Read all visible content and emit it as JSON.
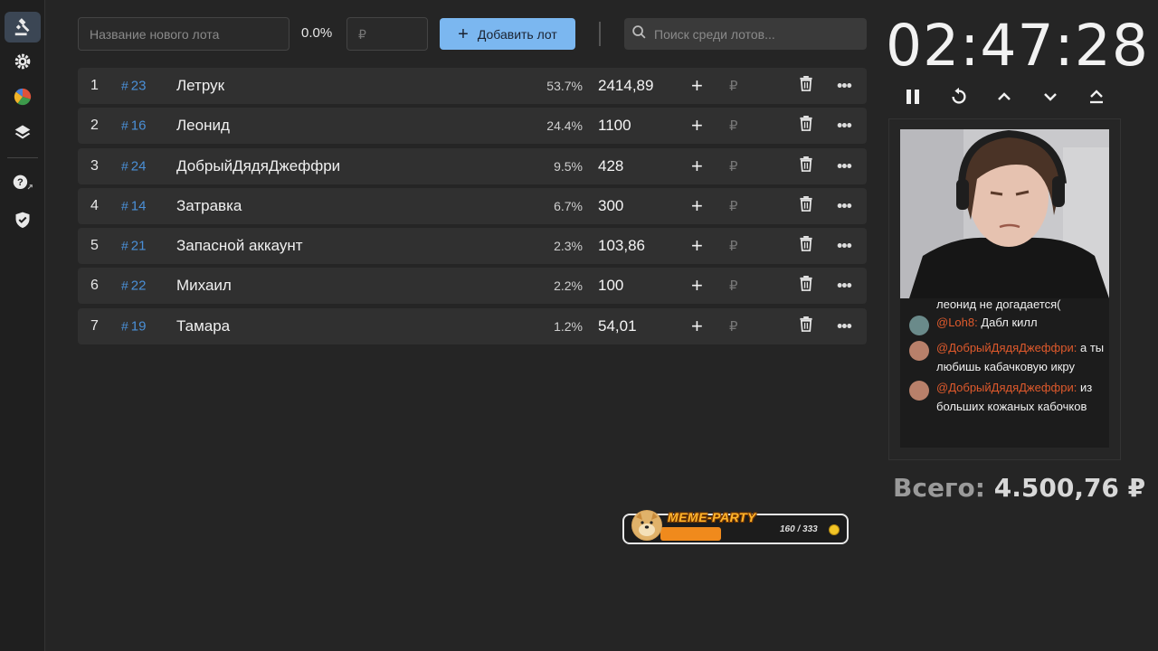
{
  "sidebar": {
    "items": [
      {
        "icon": "gavel-icon",
        "active": true
      },
      {
        "icon": "gear-icon"
      },
      {
        "icon": "pie-chart-icon"
      },
      {
        "icon": "layers-icon"
      },
      {
        "icon": "help-icon"
      },
      {
        "icon": "shield-check-icon"
      }
    ]
  },
  "toolbar": {
    "lot_name_placeholder": "Название нового лота",
    "percent": "0.0%",
    "amount_placeholder": "₽",
    "add_label": "Добавить лот",
    "search_placeholder": "Поиск среди лотов..."
  },
  "lots": [
    {
      "idx": "1",
      "num": "23",
      "name": "Летрук",
      "pct": "53.7%",
      "amount": "2414,89"
    },
    {
      "idx": "2",
      "num": "16",
      "name": "Леонид",
      "pct": "24.4%",
      "amount": "1100"
    },
    {
      "idx": "3",
      "num": "24",
      "name": "ДобрыйДядяДжеффри",
      "pct": "9.5%",
      "amount": "428"
    },
    {
      "idx": "4",
      "num": "14",
      "name": "Затравка",
      "pct": "6.7%",
      "amount": "300"
    },
    {
      "idx": "5",
      "num": "21",
      "name": "Запасной аккаунт",
      "pct": "2.3%",
      "amount": "103,86"
    },
    {
      "idx": "6",
      "num": "22",
      "name": "Михаил",
      "pct": "2.2%",
      "amount": "100"
    },
    {
      "idx": "7",
      "num": "19",
      "name": "Тамара",
      "pct": "1.2%",
      "amount": "54,01"
    }
  ],
  "row_labels": {
    "hash": "#",
    "rub": "₽"
  },
  "timer": {
    "value": "02:47:28",
    "controls": [
      "pause-icon",
      "restart-icon",
      "chevron-up-icon",
      "chevron-down-icon",
      "eject-icon"
    ]
  },
  "chat": {
    "messages": [
      {
        "user": "",
        "text": "леонид не догадается("
      },
      {
        "user": "@Loh8:",
        "text": "Дабл килл"
      },
      {
        "user": "@ДобрыйДядяДжеффри:",
        "text": "а ты любишь кабачковую икру"
      },
      {
        "user": "@ДобрыйДядяДжеффри:",
        "text": "из больших кожаных кабочков"
      }
    ]
  },
  "total": {
    "label": "Всего:",
    "value": "4.500,76 ₽"
  },
  "meme_party": {
    "title": "MEME-PARTY",
    "progress_text": "160 / 333",
    "progress": 0.48
  },
  "colors": {
    "accent": "#7bb7f0",
    "lot_number": "#4a8fd6",
    "chat_user": "#e05a2c",
    "meme_bar": "#f08a1c"
  }
}
